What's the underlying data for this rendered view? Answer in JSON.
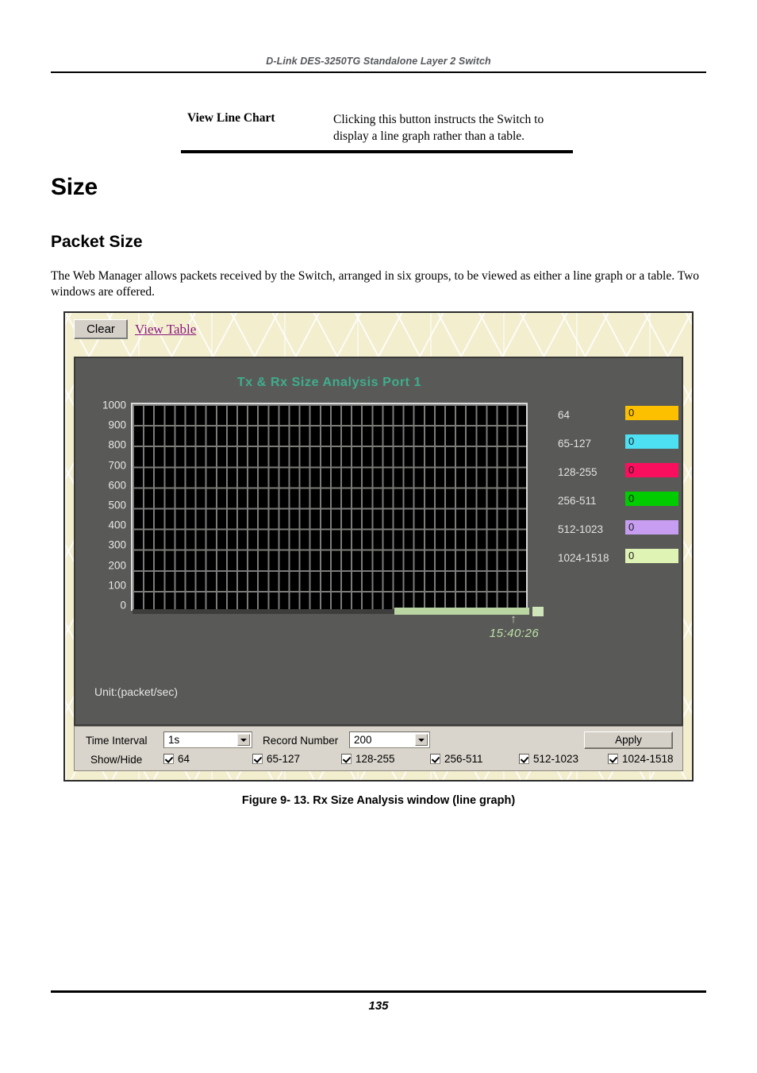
{
  "page": {
    "running_header": "D-Link DES-3250TG Standalone Layer 2 Switch",
    "page_number": "135",
    "figure_caption": "Figure 9- 13.  Rx Size Analysis window (line graph)"
  },
  "definition": {
    "term": "View Line Chart",
    "description": "Clicking this button instructs the Switch to display a line graph rather than a table."
  },
  "headings": {
    "h1": "Size",
    "h2": "Packet Size"
  },
  "body": {
    "paragraph": "The Web Manager allows packets received by the Switch, arranged in six groups, to be viewed as either a line graph or a table. Two windows are offered."
  },
  "app": {
    "toolbar": {
      "clear_button": "Clear",
      "view_table_link": "View Table"
    },
    "chart": {
      "title": "Tx & Rx Size Analysis   Port 1",
      "unit": "Unit:(packet/sec)",
      "timestamp": "15:40:26",
      "title_color": "#3fae8e",
      "timestamp_color": "#bfe0a8",
      "panel_color": "#595a57",
      "plot_background": "#000000",
      "grid_color": "#7b7b78"
    },
    "controls": {
      "time_interval_label": "Time Interval",
      "time_interval_value": "1s",
      "record_number_label": "Record Number",
      "record_number_value": "200",
      "apply_button": "Apply",
      "show_hide_label": "Show/Hide",
      "checkboxes": [
        {
          "label": "64",
          "checked": true
        },
        {
          "label": "65-127",
          "checked": true
        },
        {
          "label": "128-255",
          "checked": true
        },
        {
          "label": "256-511",
          "checked": true
        },
        {
          "label": "512-1023",
          "checked": true
        },
        {
          "label": "1024-1518",
          "checked": true
        }
      ]
    }
  },
  "chart_data": {
    "type": "line",
    "title": "Tx & Rx Size Analysis   Port 1",
    "xlabel": "",
    "ylabel": "packet/sec",
    "ylim": [
      0,
      1000
    ],
    "yticks": [
      1000,
      900,
      800,
      700,
      600,
      500,
      400,
      300,
      200,
      100,
      0
    ],
    "x": [
      "15:40:26"
    ],
    "grid": true,
    "legend_position": "right",
    "series": [
      {
        "name": "64",
        "color": "#fdc000",
        "value": "0",
        "values": [
          0
        ]
      },
      {
        "name": "65-127",
        "color": "#4de0f2",
        "value": "0",
        "values": [
          0
        ]
      },
      {
        "name": "128-255",
        "color": "#fa0f5e",
        "value": "0",
        "values": [
          0
        ]
      },
      {
        "name": "256-511",
        "color": "#00cc00",
        "value": "0",
        "values": [
          0
        ]
      },
      {
        "name": "512-1023",
        "color": "#c79df2",
        "value": "0",
        "values": [
          0
        ]
      },
      {
        "name": "1024-1518",
        "color": "#dff3b4",
        "value": "0",
        "values": [
          0
        ]
      }
    ]
  }
}
